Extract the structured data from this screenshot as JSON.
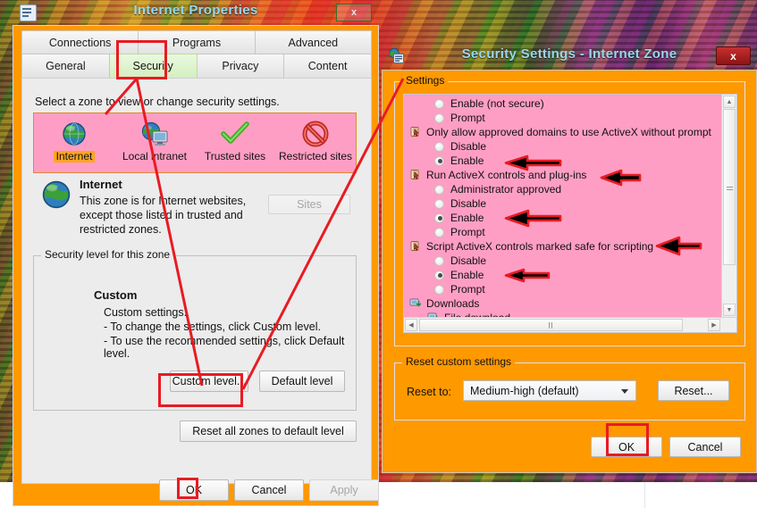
{
  "internet_properties": {
    "title": "Internet Properties",
    "close_label": "x",
    "window_icon": "properties-icon",
    "tabs_row1": [
      {
        "label": "Connections",
        "active": false
      },
      {
        "label": "Programs",
        "active": false
      },
      {
        "label": "Advanced",
        "active": false
      }
    ],
    "tabs_row2": [
      {
        "label": "General",
        "active": false
      },
      {
        "label": "Security",
        "active": true
      },
      {
        "label": "Privacy",
        "active": false
      },
      {
        "label": "Content",
        "active": false
      }
    ],
    "zone_prompt": "Select a zone to view or change security settings.",
    "zones": [
      {
        "label": "Internet",
        "icon": "globe-icon",
        "selected": true
      },
      {
        "label": "Local intranet",
        "icon": "globe-monitor-icon",
        "selected": false
      },
      {
        "label": "Trusted sites",
        "icon": "green-check-icon",
        "selected": false
      },
      {
        "label": "Restricted sites",
        "icon": "no-entry-icon",
        "selected": false
      }
    ],
    "zone_detail": {
      "icon": "globe-icon",
      "name": "Internet",
      "description_line1": "This zone is for Internet websites,",
      "description_line2": "except those listed in trusted and",
      "description_line3": "restricted zones."
    },
    "sites_button": "Sites",
    "security_group_label": "Security level for this zone",
    "level_name": "Custom",
    "level_line1": "Custom settings.",
    "level_line2": "- To change the settings, click Custom level.",
    "level_line3": "- To use the recommended settings, click Default level.",
    "custom_level_button": "Custom level...",
    "default_level_button": "Default level",
    "reset_all_button": "Reset all zones to default level",
    "ok_button": "OK",
    "cancel_button": "Cancel",
    "apply_button": "Apply"
  },
  "security_settings": {
    "title": "Security Settings - Internet Zone",
    "close_label": "x",
    "window_icon": "security-settings-icon",
    "settings_group_label": "Settings",
    "list": [
      {
        "kind": "option",
        "label": "Enable (not secure)",
        "selected": false
      },
      {
        "kind": "option",
        "label": "Prompt",
        "selected": false
      },
      {
        "kind": "category",
        "label": "Only allow approved domains to use ActiveX without prompt",
        "icon": "activex-icon"
      },
      {
        "kind": "option",
        "label": "Disable",
        "selected": false
      },
      {
        "kind": "option",
        "label": "Enable",
        "selected": true
      },
      {
        "kind": "category",
        "label": "Run ActiveX controls and plug-ins",
        "icon": "activex-icon"
      },
      {
        "kind": "option",
        "label": "Administrator approved",
        "selected": false
      },
      {
        "kind": "option",
        "label": "Disable",
        "selected": false
      },
      {
        "kind": "option",
        "label": "Enable",
        "selected": true
      },
      {
        "kind": "option",
        "label": "Prompt",
        "selected": false
      },
      {
        "kind": "category",
        "label": "Script ActiveX controls marked safe for scripting",
        "icon": "activex-icon"
      },
      {
        "kind": "option",
        "label": "Disable",
        "selected": false
      },
      {
        "kind": "option",
        "label": "Enable",
        "selected": true
      },
      {
        "kind": "option",
        "label": "Prompt",
        "selected": false
      },
      {
        "kind": "category",
        "label": "Downloads",
        "icon": "downloads-icon"
      },
      {
        "kind": "subcategory",
        "label": "File download",
        "icon": "downloads-icon"
      }
    ],
    "reset_group_label": "Reset custom settings",
    "reset_to_label": "Reset to:",
    "reset_to_value": "Medium-high (default)",
    "reset_button": "Reset...",
    "ok_button": "OK",
    "cancel_button": "Cancel"
  },
  "annotations": {
    "highlight_color": "#e81b23",
    "arrow_color": "#000000",
    "boxes": [
      "security-tab",
      "custom-level-button",
      "ok-button-properties",
      "ok-button-security"
    ],
    "arrows": [
      "arrow-enable-approved-domains",
      "arrow-run-activex",
      "arrow-enable-run-activex",
      "arrow-script-activex",
      "arrow-enable-script-activex"
    ],
    "connector": "security-tab-to-custom-level-line"
  },
  "theme": {
    "window_chrome": "#ff9900",
    "highlight_pink": "#ff9ec4",
    "selected_tab": "#d3efc0",
    "selected_zone_label": "#ffa51f"
  }
}
